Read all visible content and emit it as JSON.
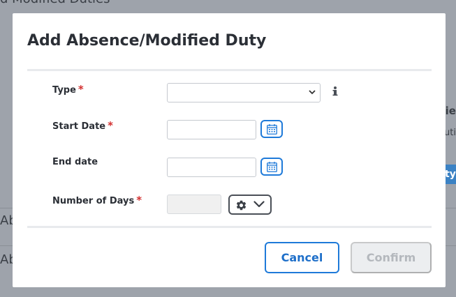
{
  "background": {
    "top_text": "d Modified Duties",
    "right_text_1": "tie",
    "right_text_2": "uti",
    "right_text_3": "ty",
    "left_text_1": "Ab",
    "left_text_2": "Ab"
  },
  "modal": {
    "title": "Add Absence/Modified Duty",
    "fields": {
      "type": {
        "label": "Type",
        "required": "*",
        "value": ""
      },
      "start_date": {
        "label": "Start Date",
        "required": "*",
        "value": ""
      },
      "end_date": {
        "label": "End date",
        "value": ""
      },
      "number_of_days": {
        "label": "Number of Days",
        "required": "*",
        "value": ""
      }
    },
    "icons": {
      "info": "info-icon",
      "calendar": "calendar-icon",
      "gear": "gear-icon",
      "chevron": "chevron-down-icon"
    },
    "buttons": {
      "cancel": "Cancel",
      "confirm": "Confirm"
    }
  },
  "colors": {
    "accent": "#1e7ad9",
    "required": "#d32f2f",
    "disabled_bg": "#eceef0",
    "disabled_text": "#b4b8bd"
  }
}
